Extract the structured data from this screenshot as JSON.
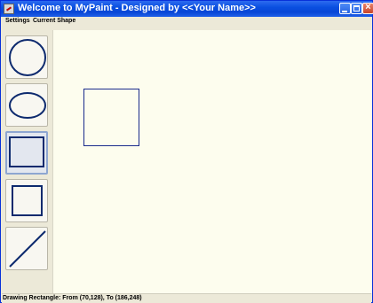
{
  "window": {
    "title": "Welcome to MyPaint - Designed by <<Your Name>>"
  },
  "menubar": {
    "items": [
      {
        "label": "Settings"
      },
      {
        "label": "Current Shape"
      }
    ]
  },
  "toolbar": {
    "tools": [
      {
        "name": "circle",
        "icon": "circle-icon",
        "selected": false
      },
      {
        "name": "ellipse",
        "icon": "ellipse-icon",
        "selected": false
      },
      {
        "name": "rectangle",
        "icon": "rectangle-icon",
        "selected": true
      },
      {
        "name": "square",
        "icon": "square-icon",
        "selected": false
      },
      {
        "name": "line",
        "icon": "line-icon",
        "selected": false
      }
    ]
  },
  "canvas": {
    "background": "#fdfdee",
    "shapes": [
      {
        "type": "rectangle",
        "stroke": "#1a2b8c"
      }
    ]
  },
  "colors": {
    "titlebar": "#0a4fe0",
    "shape_stroke": "#0d2a6e",
    "selection_border": "#8ea6d1"
  },
  "statusbar": {
    "text": "Drawing Rectangle: From (70,128), To (186,248)"
  }
}
